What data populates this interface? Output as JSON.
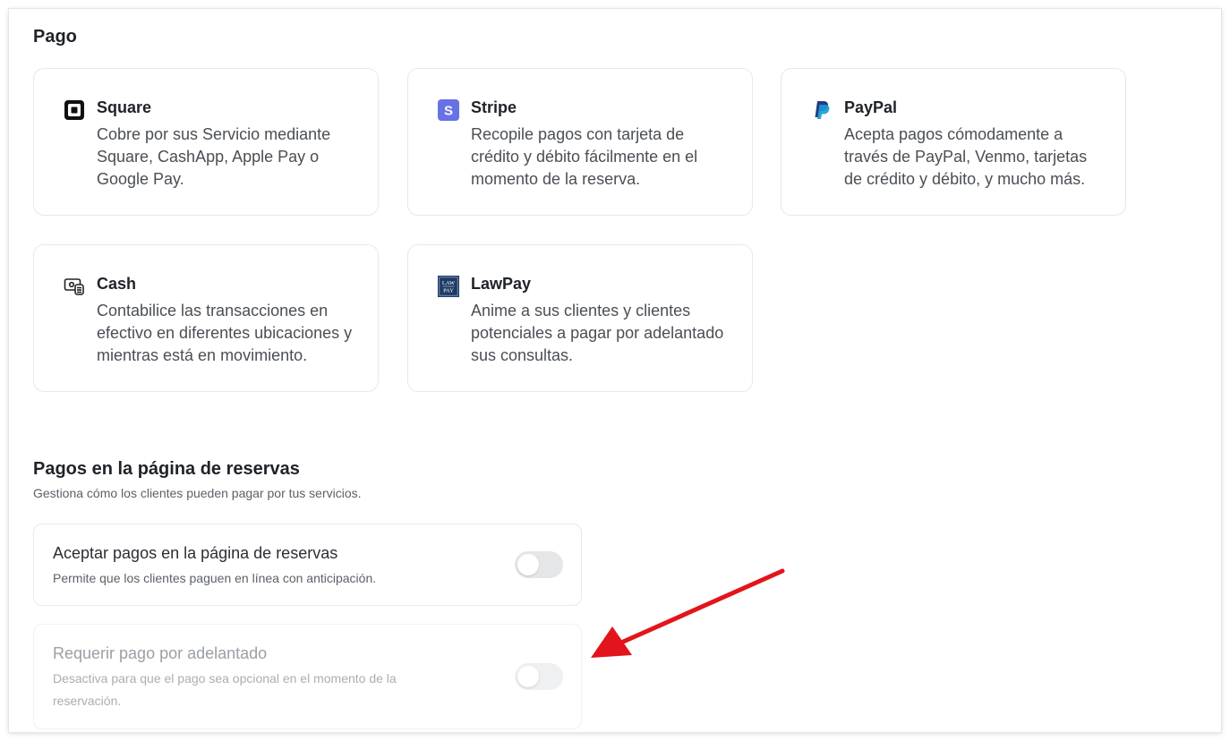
{
  "payment": {
    "title": "Pago",
    "providers": [
      {
        "name": "Square",
        "description": "Cobre por sus Servicio mediante Square, CashApp, Apple Pay o Google Pay.",
        "icon": "square-icon"
      },
      {
        "name": "Stripe",
        "description": "Recopile pagos con tarjeta de crédito y débito fácilmente en el momento de la reserva.",
        "icon": "stripe-icon",
        "icon_text": "S"
      },
      {
        "name": "PayPal",
        "description": "Acepta pagos cómodamente a través de PayPal, Venmo, tarjetas de crédito y débito, y mucho más.",
        "icon": "paypal-icon"
      },
      {
        "name": "Cash",
        "description": "Contabilice las transacciones en efectivo en diferentes ubicaciones y mientras está en movimiento.",
        "icon": "cash-icon"
      },
      {
        "name": "LawPay",
        "description": "Anime a sus clientes y clientes potenciales a pagar por adelantado sus consultas.",
        "icon": "lawpay-icon",
        "icon_text": "LAW PAY"
      }
    ]
  },
  "booking_payments": {
    "title": "Pagos en la página de reservas",
    "description": "Gestiona cómo los clientes pueden pagar por tus servicios.",
    "settings": [
      {
        "label": "Aceptar pagos en la página de reservas",
        "help": "Permite que los clientes paguen en línea con anticipación.",
        "enabled": false,
        "disabled": false
      },
      {
        "label": "Requerir pago por adelantado",
        "help": "Desactiva para que el pago sea opcional en el momento de la reservación.",
        "enabled": false,
        "disabled": true
      }
    ]
  },
  "colors": {
    "stripe": "#6772e5",
    "paypal_dark": "#253b80",
    "paypal_light": "#179bd7",
    "lawpay": "#1d3a66",
    "annotation_arrow": "#e3141b"
  }
}
